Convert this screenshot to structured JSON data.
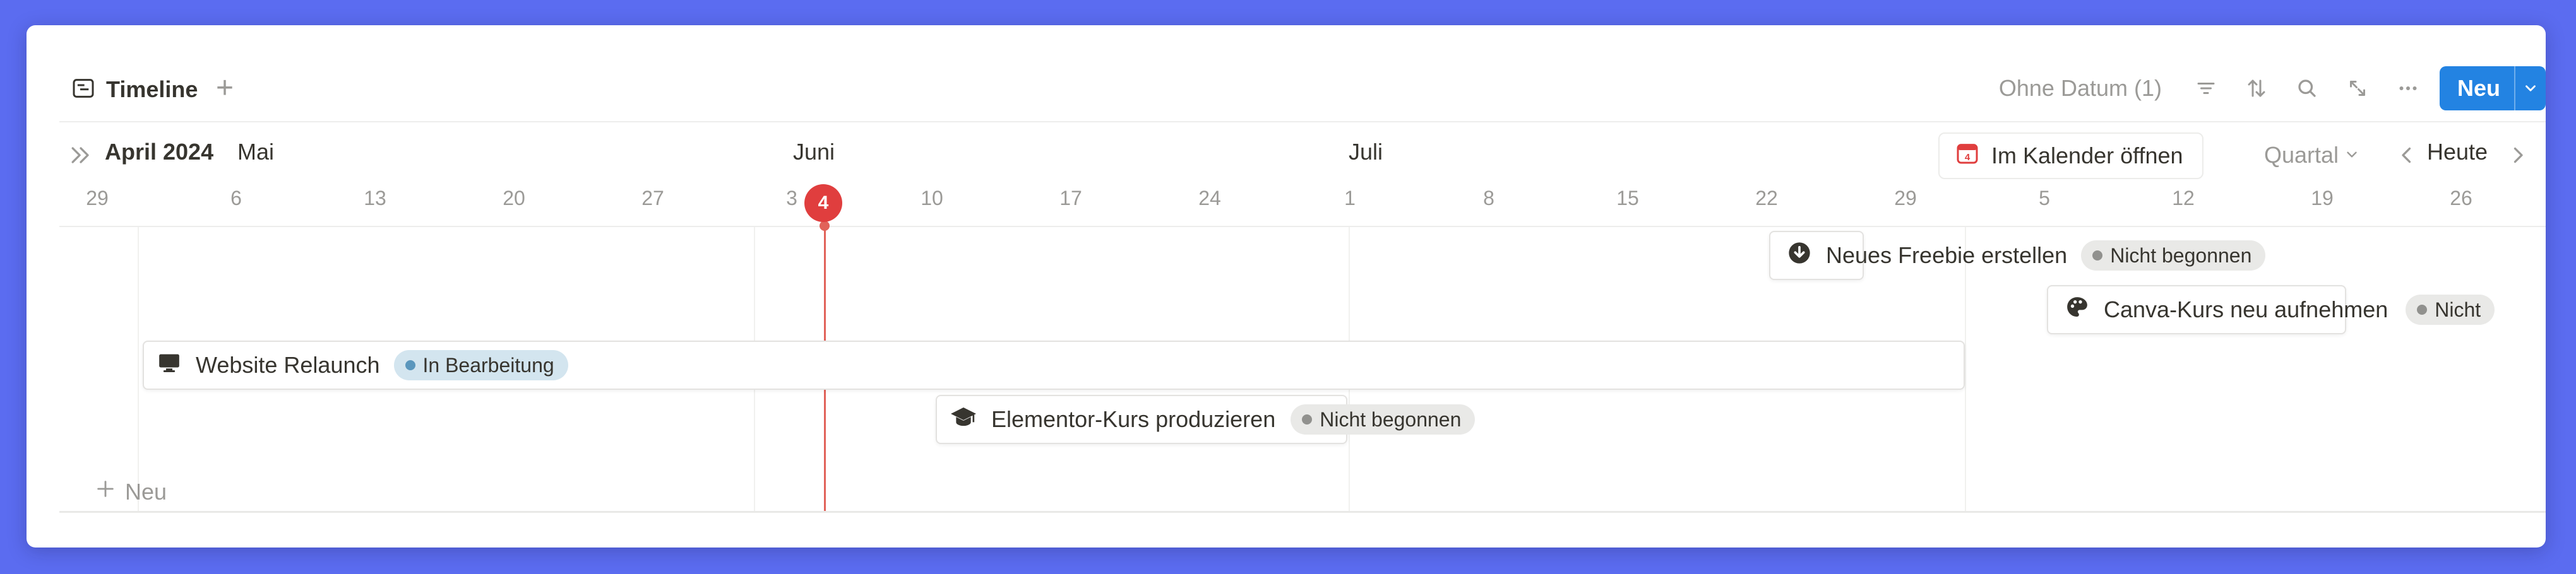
{
  "header": {
    "view_title": "Timeline",
    "add_view_symbol": "+",
    "no_date_label": "Ohne Datum (1)",
    "new_button_label": "Neu"
  },
  "timeline": {
    "months": [
      {
        "label": "April 2024",
        "bold": true
      },
      {
        "label": "Mai"
      },
      {
        "label": "Juni"
      },
      {
        "label": "Juli"
      }
    ],
    "days": [
      "29",
      "6",
      "13",
      "20",
      "27",
      "3",
      "10",
      "17",
      "24",
      "1",
      "8",
      "15",
      "22",
      "29",
      "5",
      "12",
      "19",
      "26"
    ],
    "today": "4",
    "controls": {
      "calendar_button": "Im Kalender öffnen",
      "range_select": "Quartal",
      "today_button": "Heute"
    }
  },
  "items": [
    {
      "title": "Neues Freebie erstellen",
      "icon": "download-circle-icon",
      "status": "Nicht begonnen"
    },
    {
      "title": "Canva-Kurs neu aufnehmen",
      "icon": "palette-icon",
      "status": "Nicht"
    },
    {
      "title": "Website Relaunch",
      "icon": "monitor-icon",
      "status": "In Bearbeitung"
    },
    {
      "title": "Elementor-Kurs produzieren",
      "icon": "graduation-cap-icon",
      "status": "Nicht begonnen"
    }
  ],
  "new_row_label": "Neu",
  "colors": {
    "background": "#5b6cf0",
    "accent": "#2383e2",
    "today": "#e03e3e"
  }
}
